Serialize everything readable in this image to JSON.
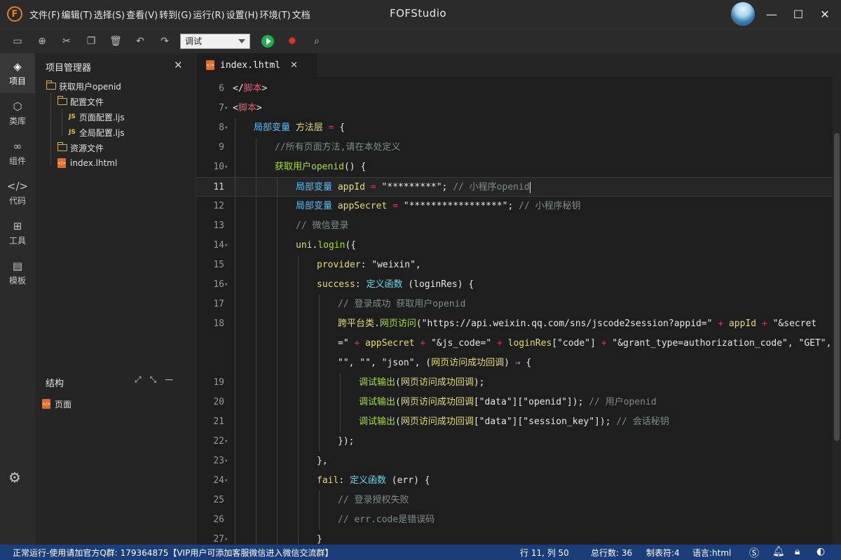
{
  "window": {
    "app_title": "FOFStudio",
    "logo_letter": "F",
    "menu": [
      "文件(F)",
      "编辑(T)",
      "选择(S)",
      "查看(V)",
      "转到(G)",
      "运行(R)",
      "设置(H)",
      "环境(T)",
      "文档"
    ],
    "controls": {
      "minimize": "—",
      "maximize": "☐",
      "close": "✕"
    }
  },
  "toolbar": {
    "icons": [
      "save-icon",
      "new-file-icon",
      "cut-icon",
      "copy-icon",
      "delete-icon",
      "undo-icon",
      "redo-icon"
    ],
    "mode_value": "调试",
    "run_icon": "play-icon",
    "debug_icon": "bug-icon",
    "inspect_icon": "search-doc-icon"
  },
  "activity": [
    {
      "label": "项目",
      "icon": "layers-icon",
      "glyph": "◈",
      "active": true
    },
    {
      "label": "类库",
      "icon": "cube-icon",
      "glyph": "⬡",
      "active": false
    },
    {
      "label": "组件",
      "icon": "link-icon",
      "glyph": "∞",
      "active": false
    },
    {
      "label": "代码",
      "icon": "code-icon",
      "glyph": "</>",
      "active": false
    },
    {
      "label": "工具",
      "icon": "tools-icon",
      "glyph": "⊞",
      "active": false
    },
    {
      "label": "模板",
      "icon": "template-icon",
      "glyph": "▤",
      "active": false
    }
  ],
  "project_panel": {
    "title": "项目管理器",
    "tree": [
      {
        "label": "获取用户openid",
        "type": "folder",
        "depth": 0
      },
      {
        "label": "配置文件",
        "type": "folder",
        "depth": 1
      },
      {
        "label": "页面配置.ljs",
        "type": "js",
        "depth": 2
      },
      {
        "label": "全局配置.ljs",
        "type": "js",
        "depth": 2
      },
      {
        "label": "资源文件",
        "type": "folder",
        "depth": 1
      },
      {
        "label": "index.lhtml",
        "type": "html",
        "depth": 1
      }
    ]
  },
  "structure_panel": {
    "title": "结构",
    "items": [
      "页面"
    ]
  },
  "editor": {
    "tab_label": "index.lhtml",
    "current_line": 11
  },
  "code_lines": [
    {
      "n": "6",
      "fold": false,
      "indent": 0,
      "tokens": [
        [
          "p",
          "</"
        ],
        [
          "t",
          "脚本"
        ],
        [
          "p",
          ">"
        ]
      ]
    },
    {
      "n": "7",
      "fold": true,
      "indent": 0,
      "tokens": [
        [
          "p",
          "<"
        ],
        [
          "t",
          "脚本"
        ],
        [
          "p",
          ">"
        ]
      ]
    },
    {
      "n": "8",
      "fold": true,
      "indent": 1,
      "tokens": [
        [
          "k",
          "局部变量 "
        ],
        [
          "s",
          "方法层"
        ],
        [
          "op",
          " = "
        ],
        [
          "p",
          "{"
        ]
      ]
    },
    {
      "n": "9",
      "fold": false,
      "indent": 2,
      "tokens": [
        [
          "c",
          "//所有页面方法,请在本处定义"
        ]
      ]
    },
    {
      "n": "10",
      "fold": true,
      "indent": 2,
      "tokens": [
        [
          "fn",
          "获取用户openid"
        ],
        [
          "p",
          "() {"
        ]
      ]
    },
    {
      "n": "11",
      "fold": false,
      "indent": 3,
      "tokens": [
        [
          "k",
          "局部变量 "
        ],
        [
          "s",
          "appId"
        ],
        [
          "op",
          " = "
        ],
        [
          "p",
          "\"*********\"; "
        ],
        [
          "c",
          "// 小程序openid"
        ]
      ]
    },
    {
      "n": "12",
      "fold": false,
      "indent": 3,
      "tokens": [
        [
          "k",
          "局部变量 "
        ],
        [
          "s",
          "appSecret"
        ],
        [
          "op",
          " = "
        ],
        [
          "p",
          "\"*****************\"; "
        ],
        [
          "c",
          "// 小程序秘钥"
        ]
      ]
    },
    {
      "n": "13",
      "fold": false,
      "indent": 3,
      "tokens": [
        [
          "c",
          "// 微信登录"
        ]
      ]
    },
    {
      "n": "14",
      "fold": true,
      "indent": 3,
      "tokens": [
        [
          "s",
          "uni"
        ],
        [
          "p",
          "."
        ],
        [
          "fn",
          "login"
        ],
        [
          "p",
          "({"
        ]
      ]
    },
    {
      "n": "15",
      "fold": false,
      "indent": 4,
      "tokens": [
        [
          "s",
          "provider"
        ],
        [
          "p",
          ": \"weixin\","
        ]
      ]
    },
    {
      "n": "16",
      "fold": true,
      "indent": 4,
      "tokens": [
        [
          "s",
          "success"
        ],
        [
          "p",
          ": "
        ],
        [
          "ty",
          "定义函数"
        ],
        [
          "p",
          " (loginRes) {"
        ]
      ]
    },
    {
      "n": "17",
      "fold": false,
      "indent": 5,
      "tokens": [
        [
          "c",
          "// 登录成功 获取用户openid"
        ]
      ]
    },
    {
      "n": "18",
      "fold": false,
      "indent": 5,
      "tokens": [
        [
          "s",
          "跨平台类"
        ],
        [
          "p",
          "."
        ],
        [
          "fn",
          "网页访问"
        ],
        [
          "p",
          "(\"https://api.weixin.qq.com/sns/jscode2session?appid=\""
        ],
        [
          "op",
          " + "
        ],
        [
          "s",
          "appId"
        ],
        [
          "op",
          " + "
        ],
        [
          "p",
          "\"&secret"
        ]
      ]
    },
    {
      "n": "",
      "fold": false,
      "indent": 5,
      "tokens": [
        [
          "p",
          "=\""
        ],
        [
          "op",
          " + "
        ],
        [
          "s",
          "appSecret"
        ],
        [
          "op",
          " + "
        ],
        [
          "p",
          "\"&js_code=\""
        ],
        [
          "op",
          " + "
        ],
        [
          "s",
          "loginRes"
        ],
        [
          "p",
          "[\"code\"]"
        ],
        [
          "op",
          " + "
        ],
        [
          "p",
          "\"&grant_type=authorization_code\", \"GET\","
        ]
      ]
    },
    {
      "n": "",
      "fold": false,
      "indent": 5,
      "tokens": [
        [
          "p",
          "\"\", \"\", \"json\", ("
        ],
        [
          "s",
          "网页访问成功回调"
        ],
        [
          "p",
          ") "
        ],
        [
          "arrow",
          "⇒"
        ],
        [
          "p",
          " {"
        ]
      ]
    },
    {
      "n": "19",
      "fold": false,
      "indent": 6,
      "tokens": [
        [
          "fn",
          "调试输出"
        ],
        [
          "p",
          "("
        ],
        [
          "s",
          "网页访问成功回调"
        ],
        [
          "p",
          ");"
        ]
      ]
    },
    {
      "n": "20",
      "fold": false,
      "indent": 6,
      "tokens": [
        [
          "fn",
          "调试输出"
        ],
        [
          "p",
          "("
        ],
        [
          "s",
          "网页访问成功回调"
        ],
        [
          "p",
          "[\"data\"][\"openid\"]); "
        ],
        [
          "c",
          "// 用户openid"
        ]
      ]
    },
    {
      "n": "21",
      "fold": false,
      "indent": 6,
      "tokens": [
        [
          "fn",
          "调试输出"
        ],
        [
          "p",
          "("
        ],
        [
          "s",
          "网页访问成功回调"
        ],
        [
          "p",
          "[\"data\"][\"session_key\"]); "
        ],
        [
          "c",
          "// 会话秘钥"
        ]
      ]
    },
    {
      "n": "22",
      "fold": true,
      "indent": 5,
      "tokens": [
        [
          "p",
          "});"
        ]
      ]
    },
    {
      "n": "23",
      "fold": true,
      "indent": 4,
      "tokens": [
        [
          "p",
          "},"
        ]
      ]
    },
    {
      "n": "24",
      "fold": true,
      "indent": 4,
      "tokens": [
        [
          "s",
          "fail"
        ],
        [
          "p",
          ": "
        ],
        [
          "ty",
          "定义函数"
        ],
        [
          "p",
          " (err) {"
        ]
      ]
    },
    {
      "n": "25",
      "fold": false,
      "indent": 5,
      "tokens": [
        [
          "c",
          "// 登录授权失败"
        ]
      ]
    },
    {
      "n": "26",
      "fold": false,
      "indent": 5,
      "tokens": [
        [
          "c",
          "// err.code是错误码"
        ]
      ]
    },
    {
      "n": "27",
      "fold": true,
      "indent": 4,
      "tokens": [
        [
          "p",
          "}"
        ]
      ]
    }
  ],
  "statusbar": {
    "message": "正常运行-使用请加官方Q群: 179364875【VIP用户可添加客服微信进入微信交流群】",
    "cursor_pos": "行 11, 列 50",
    "total_lines": "总行数: 36",
    "tab_size": "制表符:4",
    "language": "语言:html",
    "icons": [
      "dollar-icon",
      "bell-icon",
      "lock-icon",
      "theme-icon"
    ]
  }
}
